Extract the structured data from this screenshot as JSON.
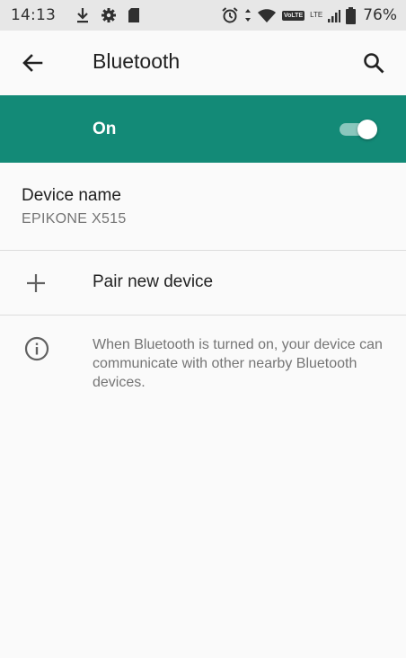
{
  "status_bar": {
    "time": "14:13",
    "battery_percent": "76%",
    "volte_label": "VoLTE",
    "network_label": "LTE",
    "left_icons": [
      "download-icon",
      "settings-icon",
      "sd-card-icon"
    ],
    "right_icons": [
      "alarm-icon",
      "data-arrows-icon",
      "wifi-icon",
      "signal-icon",
      "battery-icon"
    ]
  },
  "toolbar": {
    "title": "Bluetooth",
    "back_icon": "arrow-back-icon",
    "search_icon": "search-icon"
  },
  "master_switch": {
    "label": "On",
    "checked": true,
    "bar_color": "#138a77"
  },
  "device_name": {
    "title": "Device name",
    "value": "EPIKONE X515"
  },
  "pair_new_device": {
    "label": "Pair new device",
    "icon": "plus-icon"
  },
  "footer_info": {
    "icon": "info-icon",
    "text": "When Bluetooth is turned on, your device can communicate with other nearby Bluetooth devices."
  },
  "colors": {
    "accent": "#138a77",
    "background": "#fafafa",
    "status_bar": "#e7e7e7"
  }
}
